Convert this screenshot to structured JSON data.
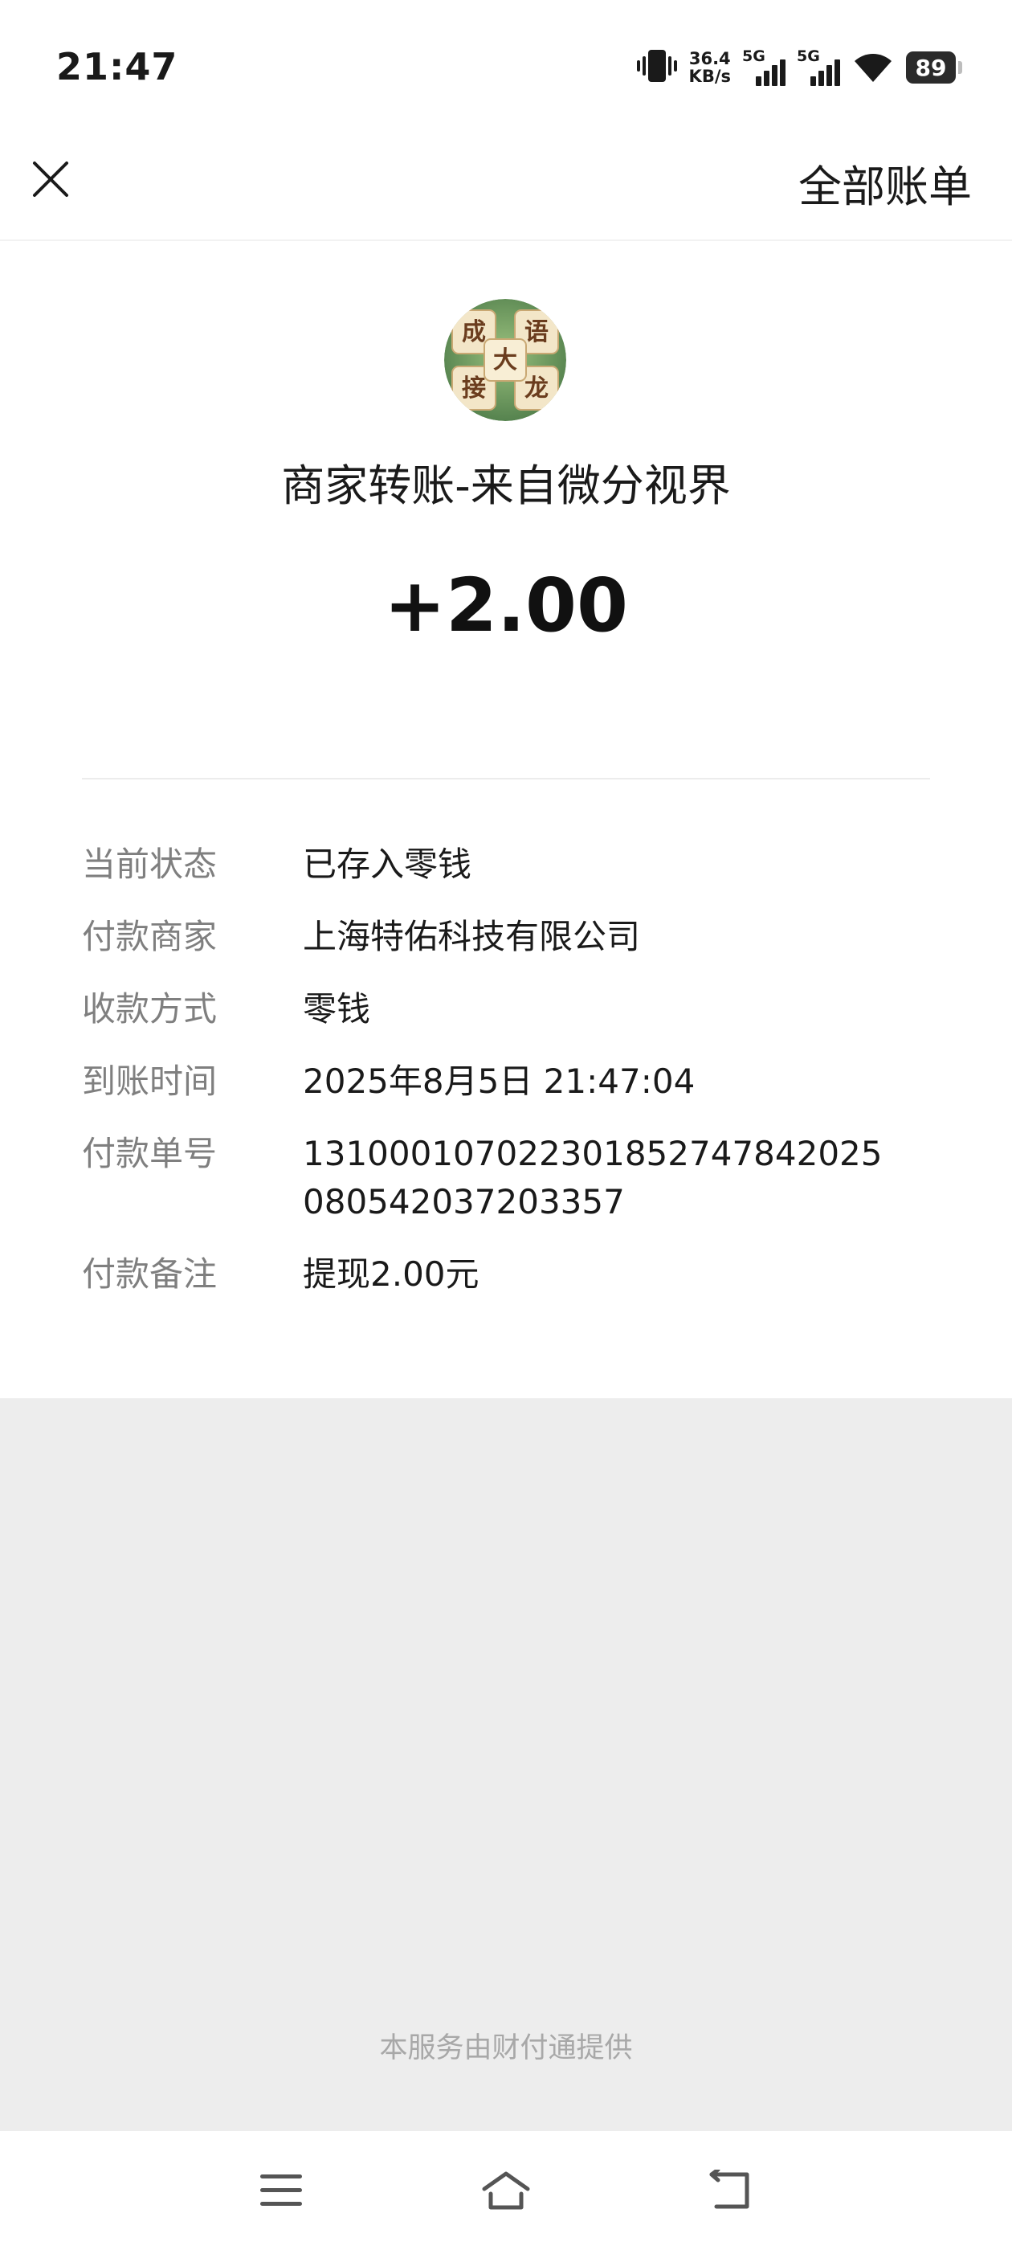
{
  "status_bar": {
    "time": "21:47",
    "net_speed_value": "36.4",
    "net_speed_unit": "KB/s",
    "sim1_label": "5G",
    "sim2_label": "5G",
    "battery": "89",
    "icons": [
      "vibrate-icon",
      "signal-icon",
      "signal-icon",
      "wifi-icon",
      "battery-icon"
    ]
  },
  "nav": {
    "close_icon": "close-icon",
    "all_bills": "全部账单"
  },
  "header": {
    "avatar_icon": "idiom-game-logo",
    "merchant_title": "商家转账-来自微分视界",
    "amount": "+2.00"
  },
  "details": [
    {
      "label": "当前状态",
      "value": "已存入零钱"
    },
    {
      "label": "付款商家",
      "value": "上海特佑科技有限公司"
    },
    {
      "label": "收款方式",
      "value": "零钱"
    },
    {
      "label": "到账时间",
      "value": "2025年8月5日 21:47:04"
    },
    {
      "label": "付款单号",
      "value": "131000107022301852747842025080542037203357"
    },
    {
      "label": "付款备注",
      "value": "提现2.00元"
    }
  ],
  "footer": {
    "note": "本服务由财付通提供"
  },
  "system_nav": {
    "icons": [
      "menu-icon",
      "home-icon",
      "back-icon"
    ]
  },
  "colors": {
    "page_bg": "#ededed",
    "card_bg": "#ffffff",
    "label_gray": "#7f7f7f",
    "footer_gray": "#a8a8a8"
  }
}
